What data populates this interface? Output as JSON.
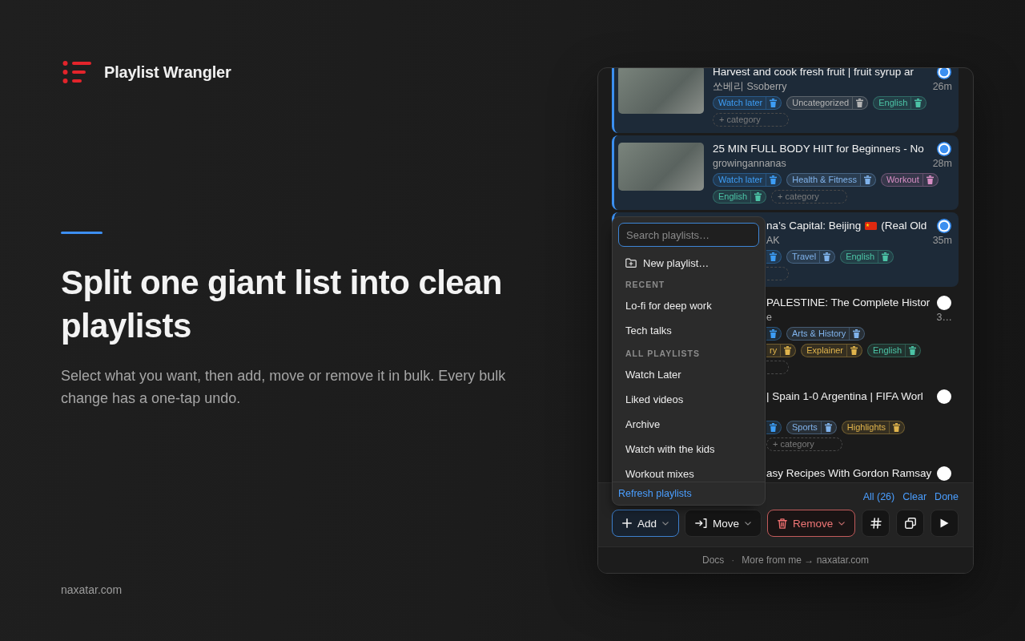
{
  "brand": {
    "name": "Playlist Wrangler"
  },
  "hero": {
    "heading": "Split one giant list into clean playlists",
    "description": "Select what you want, then add, move or remove it in bulk. Every bulk change has a one-tap undo."
  },
  "site_link": "naxatar.com",
  "panel": {
    "videos": [
      {
        "kind": "full",
        "selected": true,
        "title_parts": [
          "Harvest and cook fresh fruit | fruit syrup ar"
        ],
        "channel": "쏘베리 Ssoberry",
        "duration": "26m",
        "tag_lines": [
          [
            {
              "kind": "tag",
              "cut": false,
              "label": "Watch later",
              "color": "#3d9df5"
            },
            {
              "kind": "tag",
              "cut": false,
              "label": "Uncategorized",
              "color": "#b4b4b4"
            },
            {
              "kind": "tag",
              "cut": false,
              "label": "English",
              "color": "#4cc4a6"
            }
          ],
          [
            {
              "kind": "add",
              "cut": false,
              "label": "+ category"
            }
          ]
        ]
      },
      {
        "kind": "full",
        "selected": true,
        "title_parts": [
          "25 MIN FULL BODY HIIT for Beginners - No"
        ],
        "channel": "growingannanas",
        "duration": "28m",
        "tag_lines": [
          [
            {
              "kind": "tag",
              "cut": false,
              "label": "Watch later",
              "color": "#3d9df5"
            },
            {
              "kind": "tag",
              "cut": false,
              "label": "Health & Fitness",
              "color": "#80b3ec"
            },
            {
              "kind": "tag",
              "cut": false,
              "label": "Workout",
              "color": "#d78ec4"
            }
          ],
          [
            {
              "kind": "tag",
              "cut": false,
              "label": "English",
              "color": "#4cc4a6"
            },
            {
              "kind": "add",
              "cut": false,
              "label": "+ category"
            }
          ]
        ]
      },
      {
        "kind": "covered",
        "selected": true,
        "title_parts": [
          "na’s Capital: Beijing",
          "(Real Old"
        ],
        "channel": "AK",
        "duration": "35m",
        "tag_lines": [
          [
            {
              "kind": "tag",
              "cut": true,
              "color": "#3d9df5"
            },
            {
              "kind": "tag",
              "cut": false,
              "label": "Travel",
              "color": "#80b3ec"
            },
            {
              "kind": "tag",
              "cut": false,
              "label": "English",
              "color": "#4cc4a6"
            }
          ],
          [
            {
              "kind": "add",
              "cut": true
            }
          ]
        ]
      },
      {
        "kind": "covered",
        "selected": false,
        "title_parts": [
          "PALESTINE: The Complete Histor"
        ],
        "channel": "e",
        "duration": "3…",
        "tag_lines": [
          [
            {
              "kind": "tag",
              "cut": true,
              "color": "#3d9df5"
            },
            {
              "kind": "tag",
              "cut": false,
              "label": "Arts & History",
              "color": "#80b3ec"
            }
          ],
          [
            {
              "kind": "tag",
              "cut": true,
              "label": "ry",
              "color": "#e0b44c"
            },
            {
              "kind": "tag",
              "cut": false,
              "label": "Explainer",
              "color": "#e0b44c"
            },
            {
              "kind": "tag",
              "cut": false,
              "label": "English",
              "color": "#4cc4a6"
            }
          ],
          [
            {
              "kind": "add",
              "cut": true
            }
          ]
        ]
      },
      {
        "kind": "covered",
        "selected": false,
        "title_parts": [
          "| Spain 1-0 Argentina | FIFA Worl"
        ],
        "tag_lines": [
          [
            {
              "kind": "tag",
              "cut": true,
              "color": "#3d9df5"
            },
            {
              "kind": "tag",
              "cut": false,
              "label": "Sports",
              "color": "#80b3ec"
            },
            {
              "kind": "tag",
              "cut": false,
              "label": "Highlights",
              "color": "#e0b44c"
            }
          ],
          [
            {
              "kind": "add",
              "cut": false,
              "label": "+ category"
            }
          ]
        ]
      },
      {
        "kind": "covered",
        "selected": false,
        "title_parts": [
          "asy Recipes With Gordon Ramsay"
        ]
      }
    ],
    "add_menu": {
      "search": {
        "placeholder": "Search playlists…",
        "focused": true
      },
      "new_item": "New playlist…",
      "sections": [
        {
          "heading": "RECENT",
          "items": [
            "Lo-fi for deep work",
            "Tech talks"
          ]
        },
        {
          "heading": "ALL PLAYLISTS",
          "items": [
            "Watch Later",
            "Liked videos",
            "Archive",
            "Watch with the kids",
            "Workout mixes"
          ]
        }
      ],
      "refresh": "Refresh playlists"
    },
    "selection_links": [
      "All (26)",
      "Clear",
      "Done"
    ],
    "bulk_actions": [
      {
        "label": "Add",
        "kind": "default",
        "expanded": true
      },
      {
        "label": "Move",
        "kind": "default",
        "expanded": false
      },
      {
        "label": "Remove",
        "kind": "danger",
        "expanded": false
      }
    ],
    "footer": {
      "links": [
        "Docs",
        "More from me → naxatar.com"
      ],
      "separator": "·"
    }
  }
}
